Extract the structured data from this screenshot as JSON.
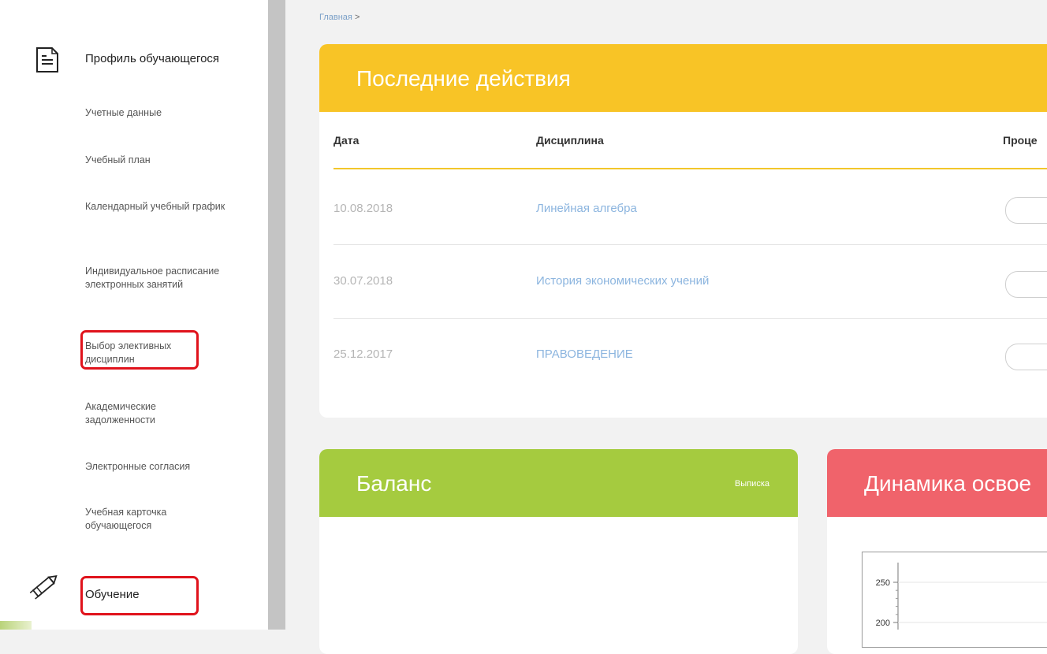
{
  "sidebar": {
    "profile_title": "Профиль обучающегося",
    "items": [
      {
        "label": "Учетные данные"
      },
      {
        "label": "Учебный план"
      },
      {
        "label": "Календарный учебный график"
      },
      {
        "label": "Индивидуальное расписание электронных занятий"
      },
      {
        "label": "Выбор элективных дисциплин"
      },
      {
        "label": "Академические задолженности"
      },
      {
        "label": "Электронные согласия"
      },
      {
        "label": "Учебная карточка обучающегося"
      }
    ],
    "study_title": "Обучение"
  },
  "breadcrumb": {
    "home": "Главная",
    "separator": ">"
  },
  "recent_actions": {
    "title": "Последние действия",
    "columns": [
      "Дата",
      "Дисциплина",
      "Проце"
    ],
    "rows": [
      {
        "date": "10.08.2018",
        "discipline": "Линейная алгебра"
      },
      {
        "date": "30.07.2018",
        "discipline": "История экономических учений"
      },
      {
        "date": "25.12.2017",
        "discipline": "ПРАВОВЕДЕНИЕ"
      }
    ]
  },
  "balance": {
    "title": "Баланс",
    "statement_link": "Выписка"
  },
  "dynamics": {
    "title": "Динамика освое"
  },
  "chart_data": {
    "type": "line",
    "y_ticks": [
      250,
      200
    ],
    "series": []
  },
  "colors": {
    "yellow": "#f8c426",
    "green": "#a5cb3f",
    "red": "#f0636b",
    "link": "#8cb5df",
    "highlight": "#e0131c"
  },
  "icons": {
    "profile": "document-list-icon",
    "study": "pencil-icon"
  }
}
